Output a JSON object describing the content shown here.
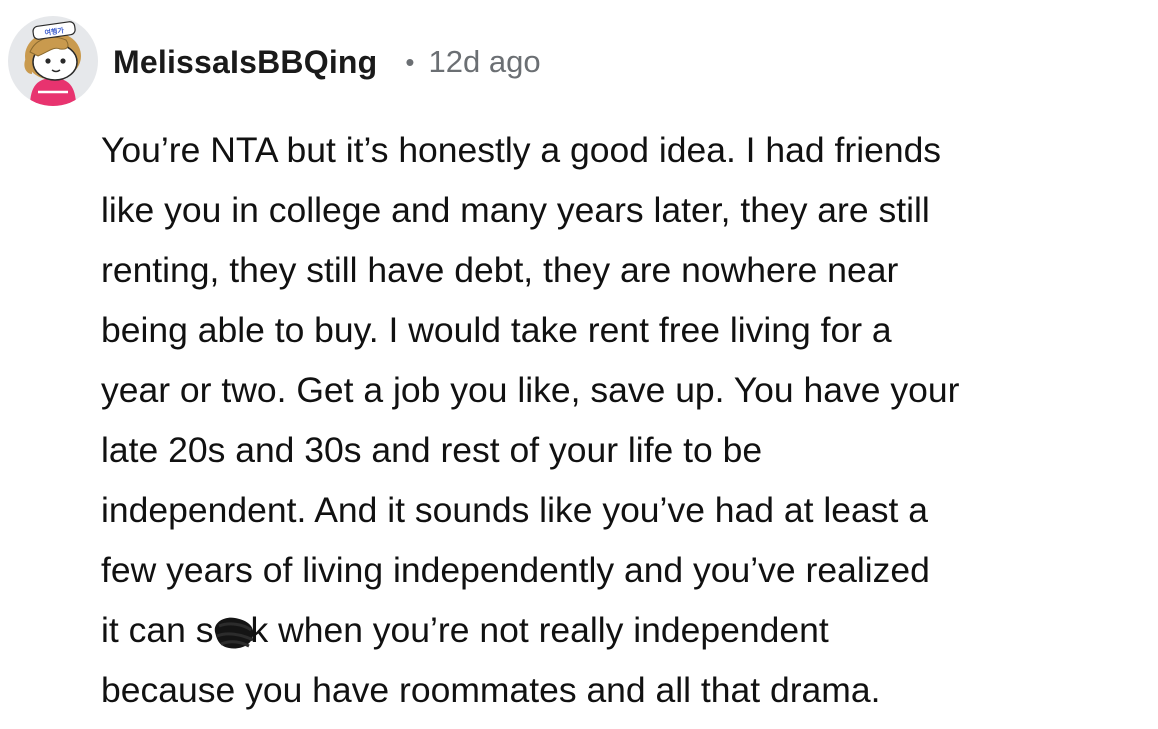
{
  "comment": {
    "username": "MelissaIsBBQing",
    "separator": "•",
    "timestamp": "12d ago",
    "avatar_icon": "snoo-avatar-icon",
    "avatar_hat_text": "여행가",
    "body_lines": [
      "You’re NTA but it’s honestly a good idea. I had friends",
      "like you in college and many years later, they are still",
      "renting, they still have debt, they are nowhere near",
      "being able to buy. I would take rent free living for a",
      "year or two. Get a job you like, save up. You have your",
      "late 20s and 30s and rest of your life to be",
      "independent. And it sounds like you’ve had at least a",
      "few years of living independently and you’ve realized",
      "because you have roommates and all that drama."
    ],
    "censored_line": {
      "before": "it can s",
      "after": "k when you’re not really independent"
    }
  },
  "colors": {
    "text": "#111111",
    "muted": "#6b6f73",
    "avatar_bg": "#e6e8eb",
    "shirt": "#e8336f",
    "hair": "#c99a4e"
  }
}
